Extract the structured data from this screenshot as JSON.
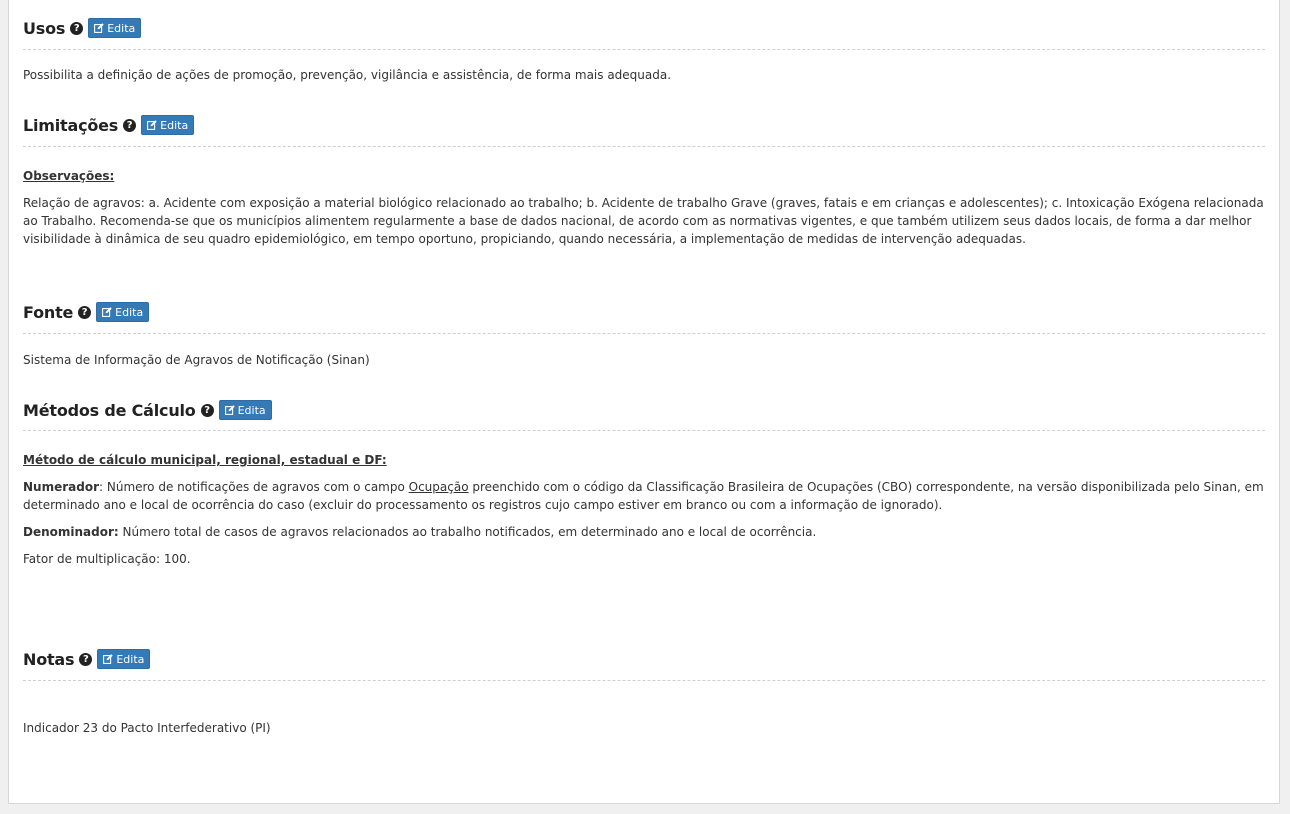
{
  "common": {
    "edit_label": "Edita",
    "help_glyph": "?"
  },
  "usos": {
    "title": "Usos",
    "body": "Possibilita a definição de ações de promoção, prevenção, vigilância e assistência, de forma mais adequada."
  },
  "limitacoes": {
    "title": "Limitações",
    "obs_label": "Observações: ",
    "body": "Relação de agravos: a. Acidente com exposição a material biológico relacionado ao trabalho; b. Acidente de trabalho Grave (graves, fatais e em crianças e adolescentes); c. Intoxicação Exógena relacionada ao Trabalho. Recomenda-se que os municípios alimentem regularmente a base de dados nacional, de acordo com as normativas vigentes, e que também utilizem seus dados locais, de forma a dar melhor visibilidade à dinâmica de seu quadro epidemiológico, em tempo oportuno, propiciando, quando necessária, a implementação de medidas de intervenção adequadas."
  },
  "fonte": {
    "title": "Fonte",
    "body": "Sistema de Informação de Agravos de Notificação (Sinan)"
  },
  "metodos": {
    "title": "Métodos de Cálculo",
    "method_label": "Método de cálculo municipal, regional, estadual e DF:",
    "numerador_label": "Numerador",
    "numerador_pre": ": Número de notificações de agravos com o campo ",
    "numerador_link": "Ocupação",
    "numerador_post": " preenchido com o código da Classificação Brasileira de Ocupações (CBO) correspondente, na versão disponibilizada pelo Sinan, em determinado ano e local de ocorrência do caso (excluir do processamento os registros cujo campo estiver em branco ou com a informação de ignorado).",
    "denominador_label": "Denominador:",
    "denominador_text": " Número total de casos de agravos relacionados ao trabalho notificados, em determinado ano e local de ocorrência.",
    "fator": "Fator de multiplicação: 100."
  },
  "notas": {
    "title": "Notas",
    "body": "Indicador 23 do Pacto Interfederativo (PI)"
  },
  "colors": {
    "button_blue": "#337ab7",
    "panel_bg": "#ffffff",
    "page_bg": "#f0f0f0"
  }
}
